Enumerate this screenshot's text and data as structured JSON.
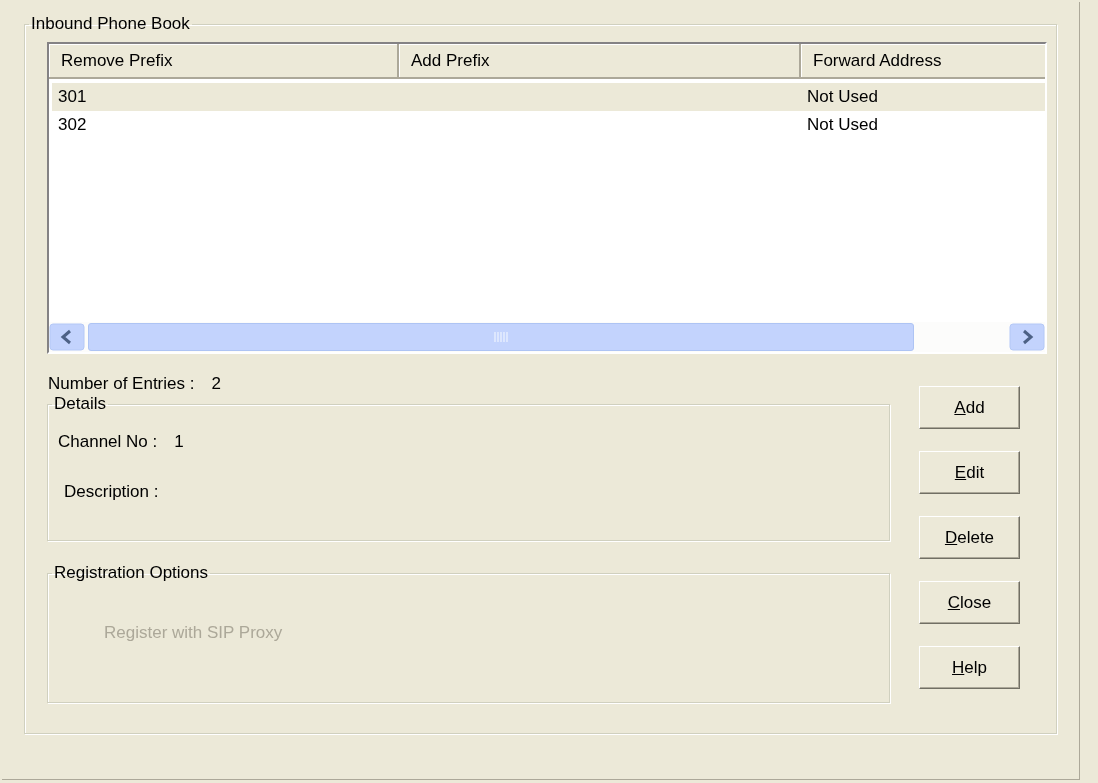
{
  "group": {
    "title": "Inbound  Phone Book"
  },
  "table": {
    "columns": [
      "Remove Prefix",
      "Add Prefix",
      "Forward Address"
    ],
    "rows": [
      {
        "cells": [
          "301",
          "",
          "Not Used"
        ],
        "selected": true
      },
      {
        "cells": [
          "302",
          "",
          "Not Used"
        ],
        "selected": false
      }
    ]
  },
  "entries": {
    "label": "Number of Entries :",
    "value": "2"
  },
  "details": {
    "title": "Details",
    "channel_label": "Channel No :",
    "channel_value": "1",
    "description_label": "Description :"
  },
  "registration": {
    "title": "Registration Options",
    "option": {
      "label": "Register with SIP Proxy",
      "disabled": true
    }
  },
  "buttons": [
    {
      "label": "Add",
      "mnemonic": true
    },
    {
      "label": "Edit",
      "mnemonic": true
    },
    {
      "label": "Delete",
      "mnemonic": true
    },
    {
      "label": "Close",
      "mnemonic": true
    },
    {
      "label": "Help",
      "mnemonic": true
    }
  ]
}
